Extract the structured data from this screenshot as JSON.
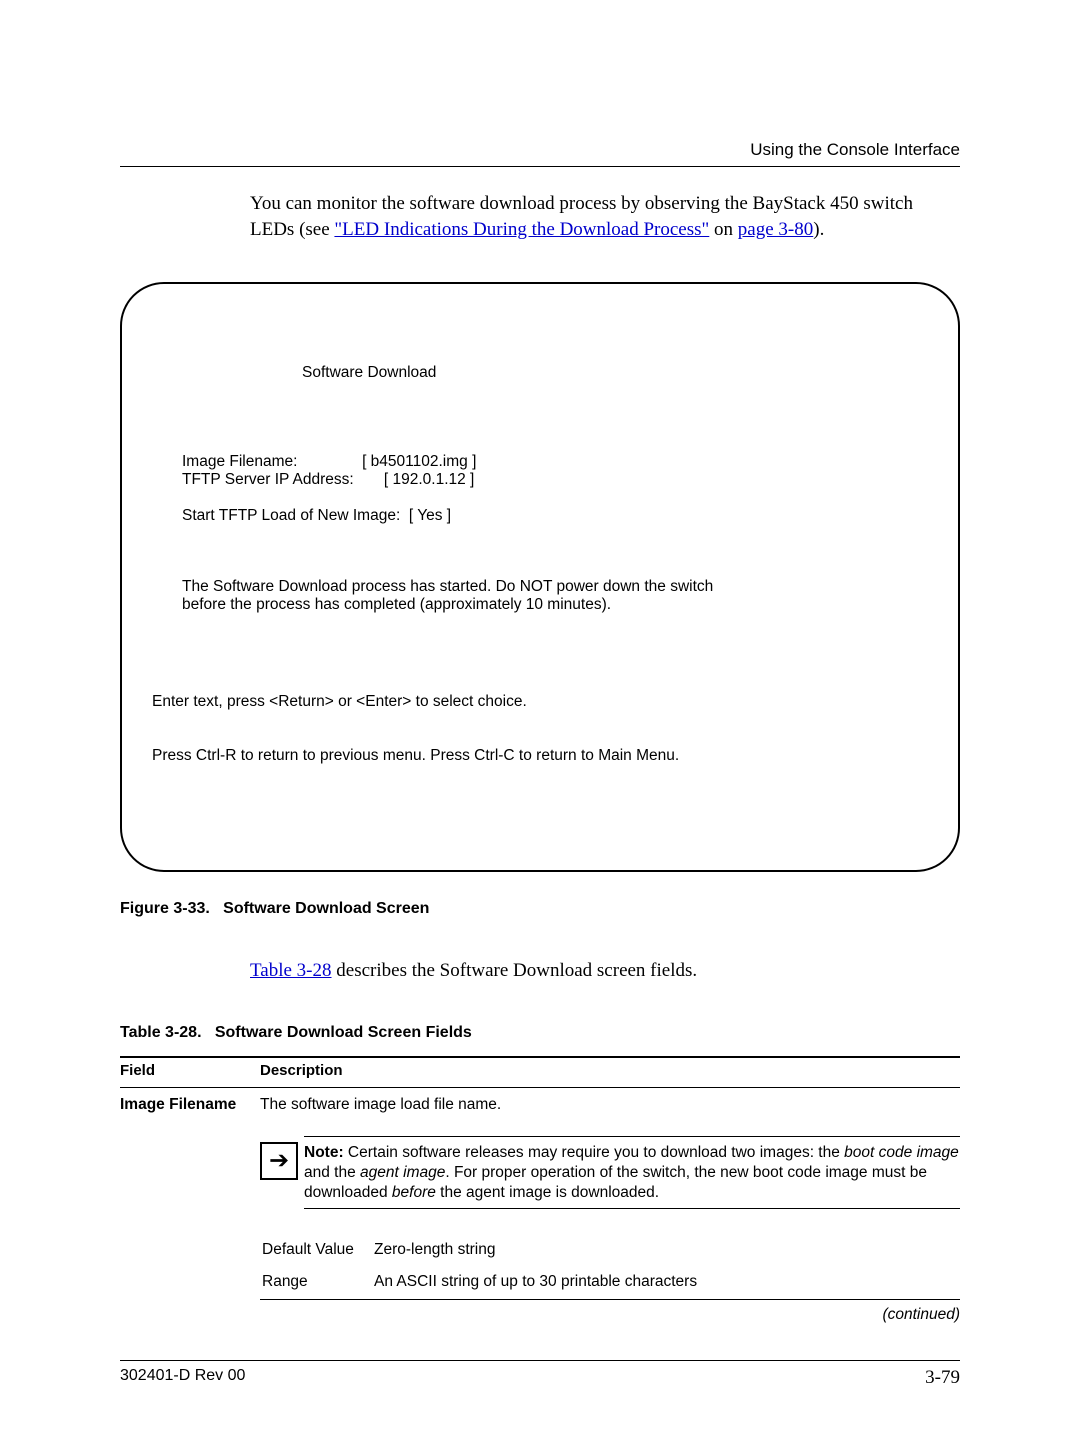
{
  "header": {
    "section": "Using the Console Interface"
  },
  "intro": {
    "pre": "You can monitor the software download process by observing the BayStack 450 switch LEDs (see ",
    "link1": "\"LED Indications During the Download Process\"",
    "mid": " on ",
    "link2": "page 3-80",
    "post": ")."
  },
  "console": {
    "title": "Software Download",
    "field1_label": "Image Filename:",
    "field1_value": "[ b4501102.img ]",
    "field2_label": "TFTP Server IP Address:",
    "field2_value": "[ 192.0.1.12 ]",
    "field3_label": "Start TFTP Load of New Image:",
    "field3_value": "[ Yes ]",
    "message": "The Software Download process has started.  Do NOT power down the switch before the process has completed (approximately 10 minutes).",
    "help1": "Enter text, press <Return> or <Enter> to select choice.",
    "help2": "Press Ctrl-R to return to previous menu.  Press Ctrl-C to return to Main Menu."
  },
  "figure": {
    "label": "Figure 3-33.",
    "title": "Software Download Screen"
  },
  "ref": {
    "link": "Table 3-28",
    "rest": " describes the Software Download screen fields."
  },
  "table": {
    "label": "Table 3-28.",
    "title": "Software Download Screen Fields",
    "col_field": "Field",
    "col_desc": "Description",
    "row1_field": "Image Filename",
    "row1_desc": "The software image load file name.",
    "note_bold": "Note:",
    "note_p1": " Certain software releases may require you to download two images: the ",
    "note_i1": "boot code image",
    "note_p2": " and the ",
    "note_i2": "agent image",
    "note_p3": ". For proper operation of the switch, the new boot code image must be downloaded ",
    "note_i3": "before",
    "note_p4": " the agent image is downloaded.",
    "default_label": "Default Value",
    "default_value": "Zero-length string",
    "range_label": "Range",
    "range_value": "An ASCII string of up to 30 printable characters",
    "continued": "(continued)"
  },
  "footer": {
    "left": "302401-D Rev 00",
    "right": "3-79"
  }
}
